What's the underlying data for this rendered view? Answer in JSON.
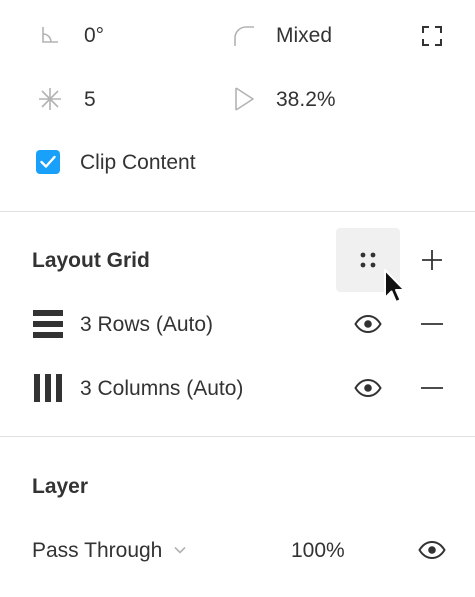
{
  "transform": {
    "rotation": "0°",
    "corner_radius": "Mixed",
    "star_count": "5",
    "star_ratio": "38.2%"
  },
  "clip_content": {
    "label": "Clip Content",
    "checked": true
  },
  "layout_grid": {
    "title": "Layout Grid",
    "grids": [
      {
        "label": "3 Rows (Auto)",
        "icon": "rows-grid-icon"
      },
      {
        "label": "3 Columns (Auto)",
        "icon": "columns-grid-icon"
      }
    ]
  },
  "layer": {
    "title": "Layer",
    "blend_mode": "Pass Through",
    "opacity": "100%"
  },
  "colors": {
    "accent": "#18a0fb",
    "text": "#333333",
    "icon": "#333333",
    "icon_muted": "#b3b3b3",
    "divider": "#e0e0e0",
    "hover": "#f0f0f0"
  }
}
